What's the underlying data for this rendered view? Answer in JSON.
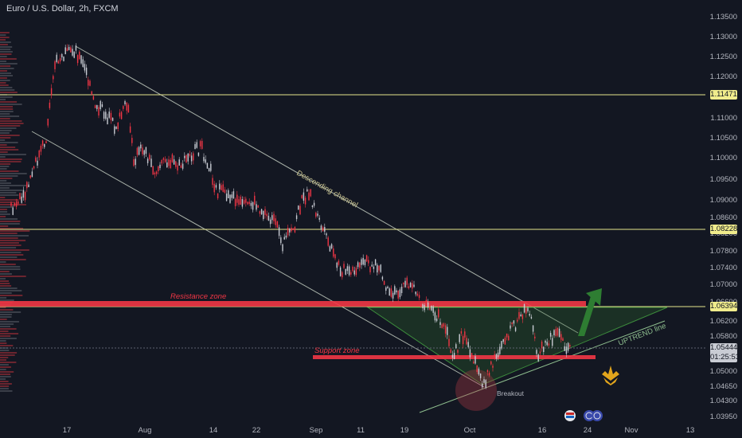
{
  "header": {
    "title": "Euro / U.S. Dollar, 2h, FXCM"
  },
  "price_axis": {
    "ticks": [
      "1.13500",
      "1.13000",
      "1.12500",
      "1.12000",
      "1.11500",
      "1.11000",
      "1.10500",
      "1.10000",
      "1.09500",
      "1.09000",
      "1.08600",
      "1.08200",
      "1.07800",
      "1.07400",
      "1.07000",
      "1.06600",
      "1.06200",
      "1.05800",
      "1.05000",
      "1.04650",
      "1.04300",
      "1.03950"
    ],
    "badges": {
      "level_1": "1.11471",
      "level_2": "1.08228",
      "level_3": "1.06394",
      "current_price": "1.05444",
      "countdown": "01:25:53"
    }
  },
  "time_axis": {
    "ticks": [
      "17",
      "Aug",
      "14",
      "22",
      "Sep",
      "11",
      "19",
      "Oct",
      "16",
      "24",
      "Nov",
      "13"
    ]
  },
  "annotations": {
    "resistance": "Resistance zone",
    "support": "Support zone",
    "channel": "Descending channel",
    "uptrend": "UPTREND line",
    "breakout": "Breakout"
  },
  "colors": {
    "background": "#131722",
    "bear": "#f23645",
    "bull": "#c9ccd4",
    "level_line": "#e6e68c",
    "zone": "#f23645",
    "arrow": "#2e7d32"
  },
  "icons": {
    "event_1": "flag-icon",
    "event_2": "globe-icon",
    "event_3": "globe-icon",
    "logo": "crown-logo-icon"
  }
}
